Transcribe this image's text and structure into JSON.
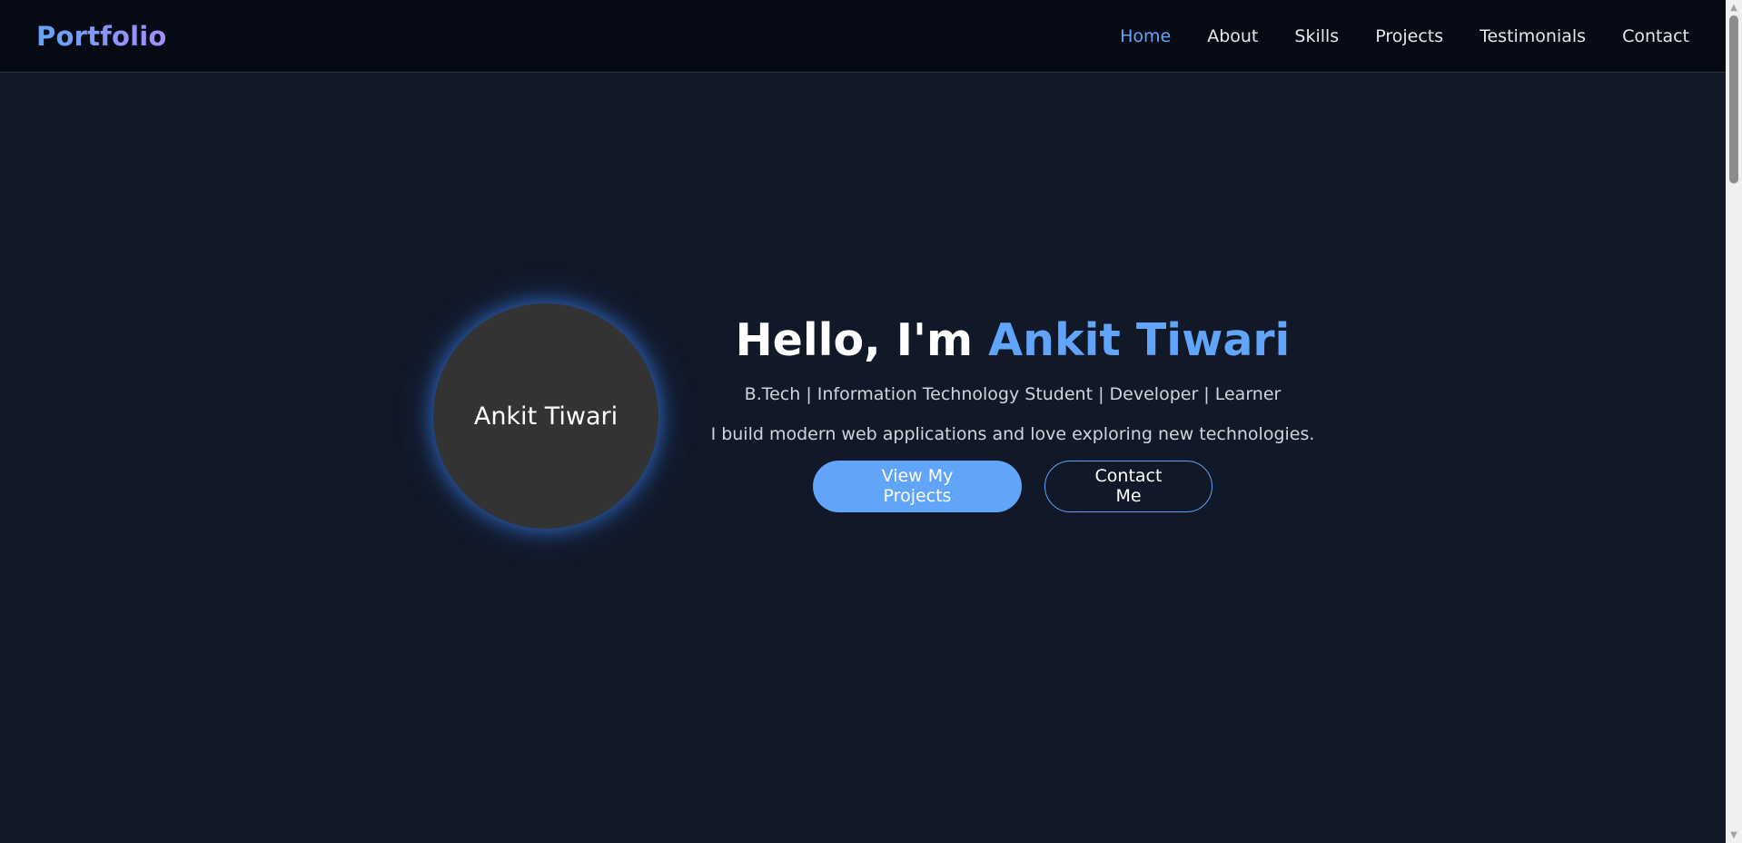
{
  "nav": {
    "logo": "Portfolio",
    "links": [
      {
        "label": "Home",
        "active": true
      },
      {
        "label": "About",
        "active": false
      },
      {
        "label": "Skills",
        "active": false
      },
      {
        "label": "Projects",
        "active": false
      },
      {
        "label": "Testimonials",
        "active": false
      },
      {
        "label": "Contact",
        "active": false
      }
    ]
  },
  "hero": {
    "avatar_label": "Ankit Tiwari",
    "greeting": "Hello, I'm ",
    "name": "Ankit Tiwari",
    "subtitle": "B.Tech | Information Technology Student | Developer | Learner",
    "description": "I build modern web applications and love exploring new technologies.",
    "primary_button": "View My Projects",
    "secondary_button": "Contact Me"
  },
  "colors": {
    "accent": "#60a5fa",
    "background": "#111827",
    "navbar": "#050a14",
    "avatar": "#333333"
  },
  "scrollbar": {
    "up_icon": "scroll-up-arrow-icon",
    "down_icon": "scroll-down-arrow-icon"
  }
}
